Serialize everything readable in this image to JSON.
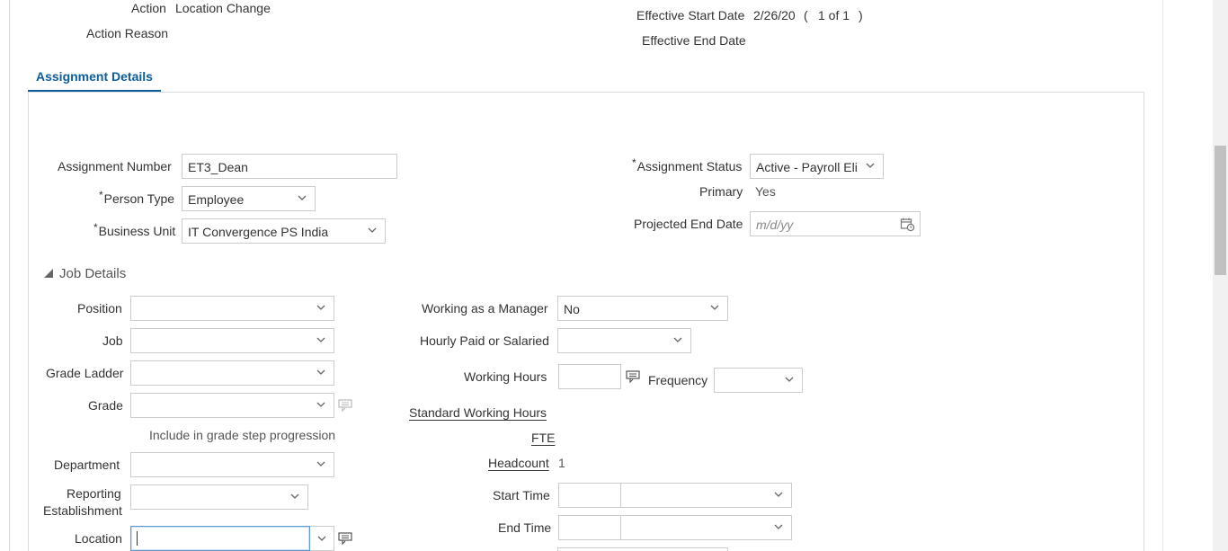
{
  "header": {
    "action_label": "Action",
    "action_value": "Location Change",
    "action_reason_label": "Action Reason",
    "effective_start_label": "Effective Start Date",
    "effective_start_value": "2/26/20",
    "record_position_open": "(",
    "record_position": "1 of 1",
    "record_position_close": ")",
    "effective_end_label": "Effective End Date"
  },
  "tabs": [
    {
      "label": "Assignment Details",
      "selected": true
    }
  ],
  "assignment": {
    "assignment_number_label": "Assignment Number",
    "assignment_number_value": "ET3_Dean",
    "person_type_required": "*",
    "person_type_label": "Person Type",
    "person_type_value": "Employee",
    "business_unit_required": "*",
    "business_unit_label": "Business Unit",
    "business_unit_value": "IT Convergence PS India",
    "assignment_status_required": "*",
    "assignment_status_label": "Assignment Status",
    "assignment_status_value": "Active - Payroll Eli",
    "primary_label": "Primary",
    "primary_value": "Yes",
    "projected_end_label": "Projected End Date",
    "projected_end_placeholder": "m/d/yy"
  },
  "job_details": {
    "section_title": "Job Details",
    "position_label": "Position",
    "job_label": "Job",
    "grade_ladder_label": "Grade Ladder",
    "grade_label": "Grade",
    "include_grade_step_label": "Include in grade step progression",
    "department_label": "Department",
    "reporting_establishment_label_line1": "Reporting",
    "reporting_establishment_label_line2": "Establishment",
    "location_label": "Location",
    "working_as_manager_label": "Working as a Manager",
    "working_as_manager_value": "No",
    "hourly_paid_label": "Hourly Paid or Salaried",
    "working_hours_label": "Working Hours",
    "frequency_label": "Frequency",
    "standard_working_hours_label": "Standard Working Hours",
    "fte_label": "FTE",
    "headcount_label": "Headcount",
    "headcount_value": "1",
    "start_time_label": "Start Time",
    "end_time_label": "End Time"
  },
  "icons": {
    "dropdown": "chevron-down-icon",
    "calendar": "calendar-icon",
    "details": "details-list-icon",
    "collapse": "triangle-collapse-icon"
  },
  "colors": {
    "accent": "#0d5c9e",
    "border": "#c9ccd0",
    "focus": "#5d9bd8"
  }
}
